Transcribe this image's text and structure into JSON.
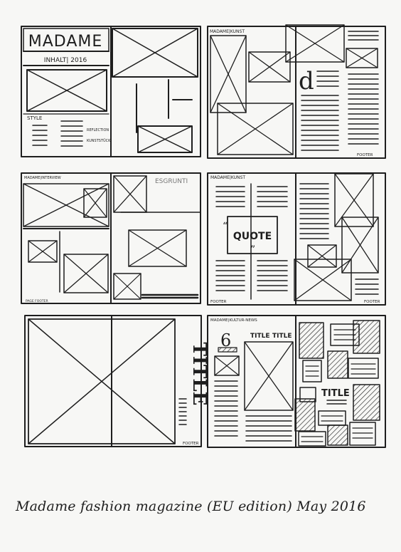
{
  "spreads": [
    {
      "id": "spread-1",
      "left": {
        "masthead": "MADAME",
        "subhead": "INHALT| 2016",
        "label_style": "STYLE",
        "label_reflection": "REFLECTION",
        "label_kunststueck": "KUNSTSTÜCK"
      },
      "right": {}
    },
    {
      "id": "spread-2",
      "left": {
        "header": "MADAME|KUNST",
        "drop_cap": "d"
      },
      "right": {
        "footer": "FOOTER"
      }
    },
    {
      "id": "spread-3",
      "left": {
        "header": "MADAME|INTERVIEW",
        "footer": "PAGE FOOTER"
      },
      "right": {
        "label": "ESGRUNTI"
      }
    },
    {
      "id": "spread-4",
      "left": {
        "header": "MADAME|KUNST",
        "quote": "QUOTE",
        "footer": "FOOTER"
      },
      "right": {
        "footer": "FOOTER"
      }
    },
    {
      "id": "spread-5",
      "left": {},
      "right": {
        "title": "TITLE",
        "footer": "FOOTER"
      }
    },
    {
      "id": "spread-6",
      "left": {
        "header": "MADAME|KULTUR-NEWS",
        "number": "6",
        "title": "TITLE"
      },
      "right": {
        "title_small": "TITLE",
        "title": "TITLE"
      }
    }
  ],
  "caption": "Madame fashion magazine (EU edition) May 2016"
}
